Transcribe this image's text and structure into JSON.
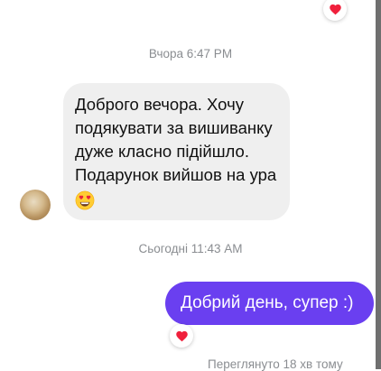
{
  "conversation": {
    "timestamp_yesterday": "Вчора 6:47 PM",
    "timestamp_today": "Сьогодні 11:43 AM",
    "incoming_message": {
      "lines": [
        "Доброго вечора. Хочу",
        "подякувати за вишиванку",
        "дуже класно підійшло.",
        "Подарунок вийшов на ура"
      ],
      "emoji": "smiling-face-with-heart-eyes"
    },
    "outgoing_message": {
      "text": "Добрий день, супер :)"
    },
    "reactions": {
      "top_reaction": "red-heart",
      "outgoing_reaction": "red-heart"
    },
    "seen_status": "Переглянуто 18 хв тому"
  },
  "colors": {
    "outgoing_bubble": "#6a3ff0",
    "incoming_bubble": "#efefef",
    "heart": "#f0203c",
    "meta_text": "#8a8d91"
  }
}
